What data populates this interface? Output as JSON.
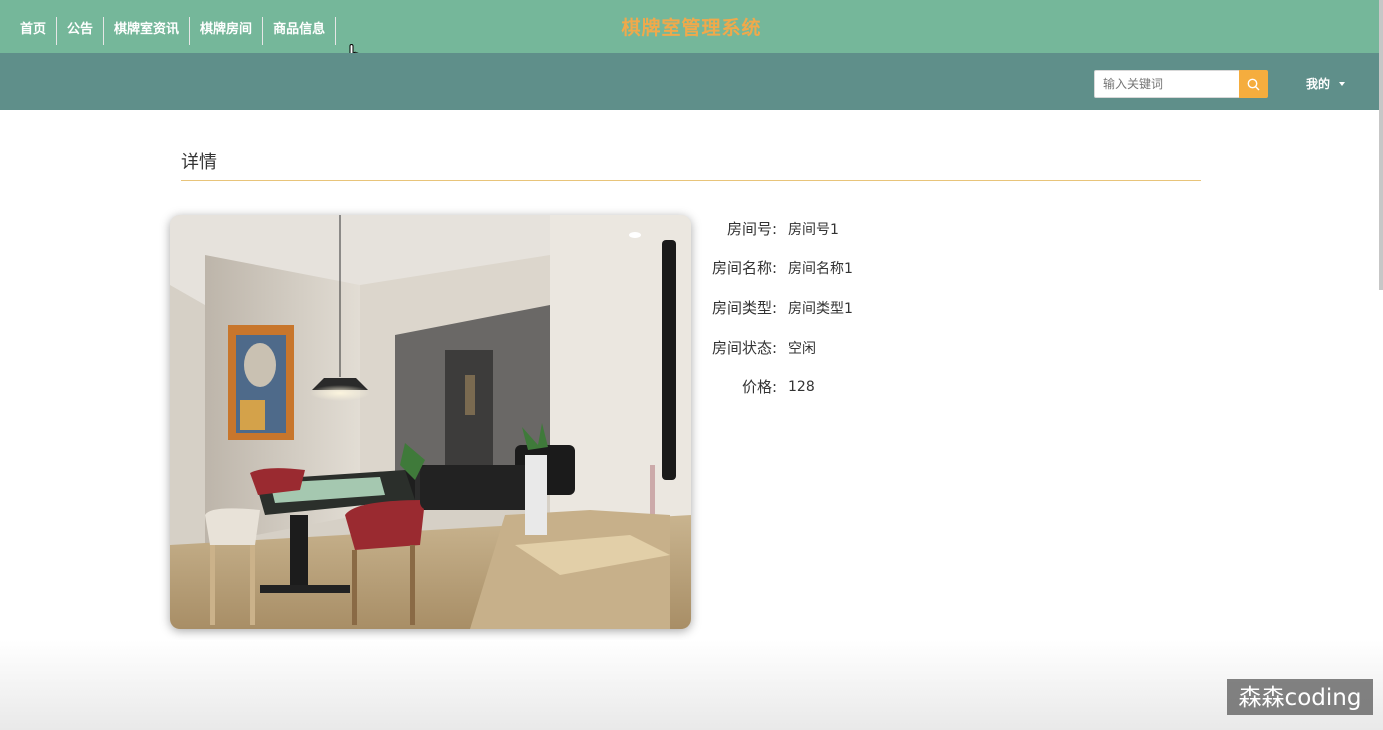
{
  "header": {
    "title": "棋牌室管理系统"
  },
  "nav": {
    "items": [
      {
        "label": "首页"
      },
      {
        "label": "公告"
      },
      {
        "label": "棋牌室资讯"
      },
      {
        "label": "棋牌房间"
      },
      {
        "label": "商品信息"
      }
    ],
    "search_placeholder": "输入关键词",
    "user_menu_label": "我的"
  },
  "colors": {
    "title_bar_bg": "#75b79a",
    "title_text": "#f0a94b",
    "nav_bg": "#5f8f8a",
    "search_button": "#f5ad3e",
    "divider": "#e8c47a"
  },
  "icons": {
    "search": "search-icon",
    "caret": "chevron-down-icon",
    "cursor": "hand-pointer-icon"
  },
  "page": {
    "section_title": "详情"
  },
  "detail": {
    "fields": [
      {
        "label": "房间号:",
        "value": "房间号1"
      },
      {
        "label": "房间名称:",
        "value": "房间名称1"
      },
      {
        "label": "房间类型:",
        "value": "房间类型1"
      },
      {
        "label": "房间状态:",
        "value": "空闲"
      },
      {
        "label": "价格:",
        "value": "128"
      }
    ]
  },
  "watermark": "森森coding"
}
